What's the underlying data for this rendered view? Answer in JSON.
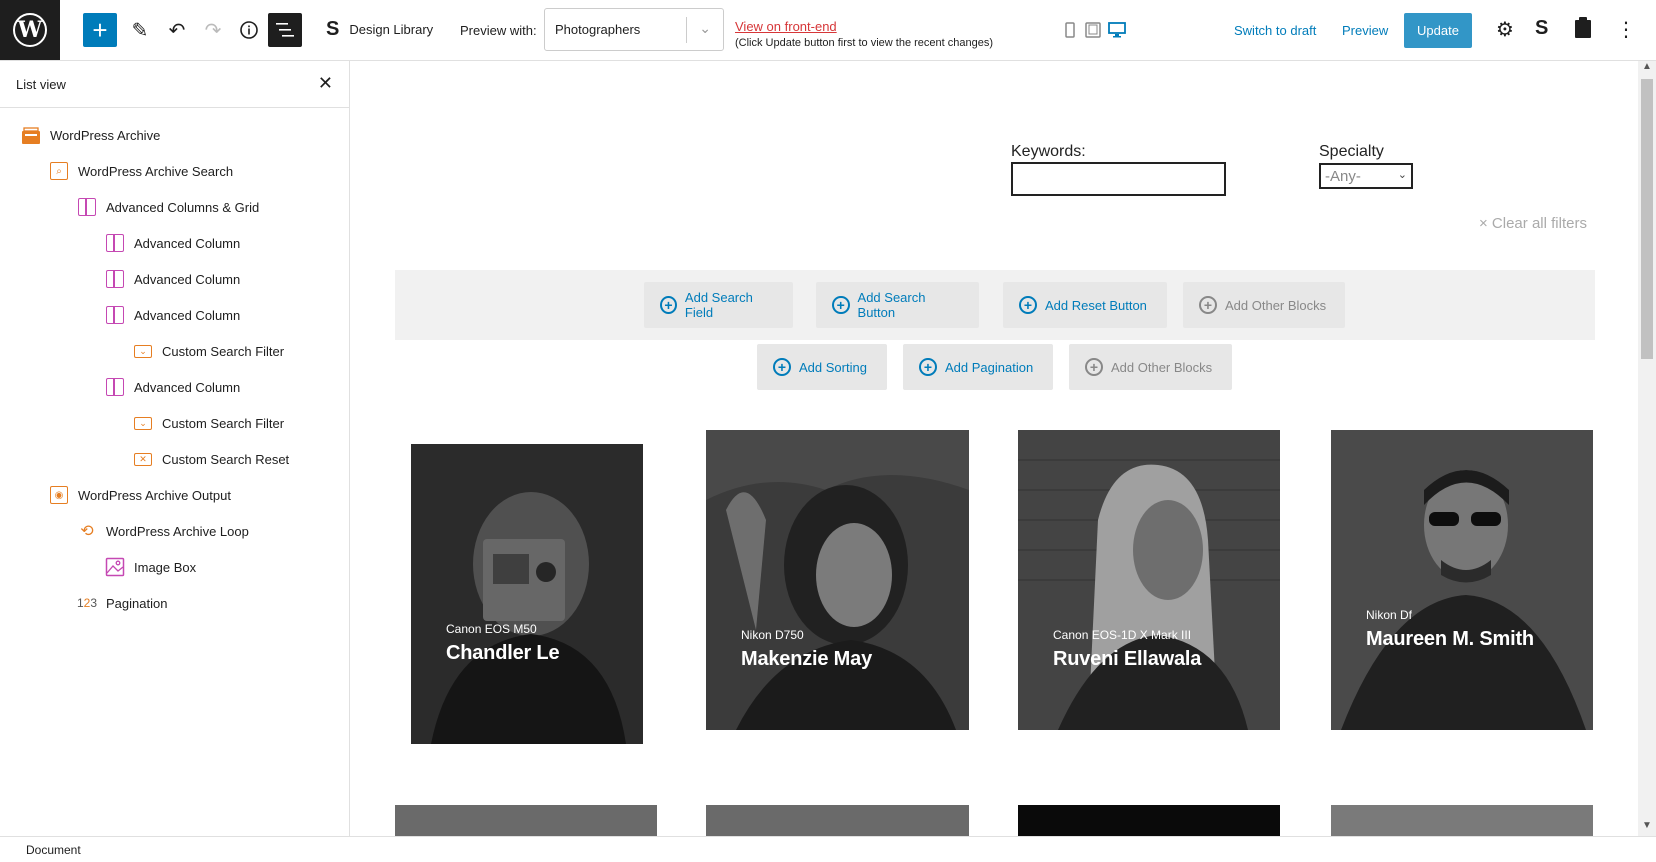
{
  "toolbar": {
    "design_library": "Design Library",
    "preview_with_label": "Preview with:",
    "preview_with_value": "Photographers",
    "view_front_end": "View on front-end",
    "view_front_end_note": "(Click Update button first to view the recent changes)",
    "switch_to_draft": "Switch to draft",
    "preview": "Preview",
    "update": "Update"
  },
  "sidebar": {
    "title": "List view",
    "items": [
      {
        "label": "WordPress Archive",
        "icon": "archive-icon"
      },
      {
        "label": "WordPress Archive Search",
        "icon": "search-icon"
      },
      {
        "label": "Advanced Columns & Grid",
        "icon": "columns-icon"
      },
      {
        "label": "Advanced Column",
        "icon": "column-icon"
      },
      {
        "label": "Advanced Column",
        "icon": "column-icon"
      },
      {
        "label": "Advanced Column",
        "icon": "column-icon"
      },
      {
        "label": "Custom Search Filter",
        "icon": "filter-icon"
      },
      {
        "label": "Advanced Column",
        "icon": "column-icon"
      },
      {
        "label": "Custom Search Filter",
        "icon": "filter-icon"
      },
      {
        "label": "Custom Search Reset",
        "icon": "reset-icon"
      },
      {
        "label": "WordPress Archive Output",
        "icon": "eye-icon"
      },
      {
        "label": "WordPress Archive Loop",
        "icon": "loop-icon"
      },
      {
        "label": "Image Box",
        "icon": "image-icon"
      },
      {
        "label": "Pagination",
        "icon": "pagination-icon"
      }
    ]
  },
  "canvas": {
    "keywords_label": "Keywords:",
    "specialty_label": "Specialty",
    "specialty_value": "-Any-",
    "clear_filters": "× Clear all filters",
    "buttons_row1": [
      "Add Search Field",
      "Add Search Button",
      "Add Reset Button",
      "Add Other Blocks"
    ],
    "buttons_row2": [
      "Add Sorting",
      "Add Pagination",
      "Add Other Blocks"
    ],
    "cards": [
      {
        "camera": "Canon EOS M50",
        "name": "Chandler Le"
      },
      {
        "camera": "Nikon D750",
        "name": "Makenzie May"
      },
      {
        "camera": "Canon EOS-1D X Mark III",
        "name": "Ruveni Ellawala"
      },
      {
        "camera": "Nikon Df",
        "name": "Maureen M. Smith"
      }
    ]
  },
  "footer": {
    "label": "Document"
  },
  "colors": {
    "accent": "#007cba",
    "warning": "#d63638",
    "block_orange": "#e67e22",
    "block_pink": "#c548b3"
  }
}
